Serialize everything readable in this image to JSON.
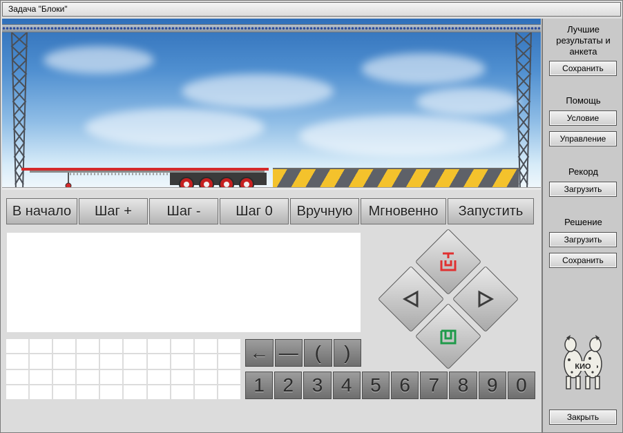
{
  "window": {
    "title": "Задача \"Блоки\""
  },
  "controls": {
    "to_start": "В начало",
    "step_plus": "Шаг +",
    "step_minus": "Шаг -",
    "step_zero": "Шаг 0",
    "manual": "Вручную",
    "instant": "Мгновенно",
    "run": "Запустить"
  },
  "keypad": {
    "symbols": [
      "←",
      "—",
      "(",
      ")"
    ],
    "digits": [
      "1",
      "2",
      "3",
      "4",
      "5",
      "6",
      "7",
      "8",
      "9",
      "0"
    ]
  },
  "sidebar": {
    "best_results_label": "Лучшие результаты и анкета",
    "save_results_button": "Сохранить",
    "help_label": "Помощь",
    "condition_button": "Условие",
    "management_button": "Управление",
    "record_label": "Рекорд",
    "record_load_button": "Загрузить",
    "solution_label": "Решение",
    "solution_load_button": "Загрузить",
    "solution_save_button": "Сохранить",
    "close_button": "Закрыть",
    "logo_text": "КИО"
  },
  "colors": {
    "lift_icon": "#e03030",
    "drop_icon": "#1f9a4a",
    "stripe_yellow": "#f4c22c",
    "stripe_gray": "#5e6168",
    "trailer_red": "#d42a2a"
  }
}
